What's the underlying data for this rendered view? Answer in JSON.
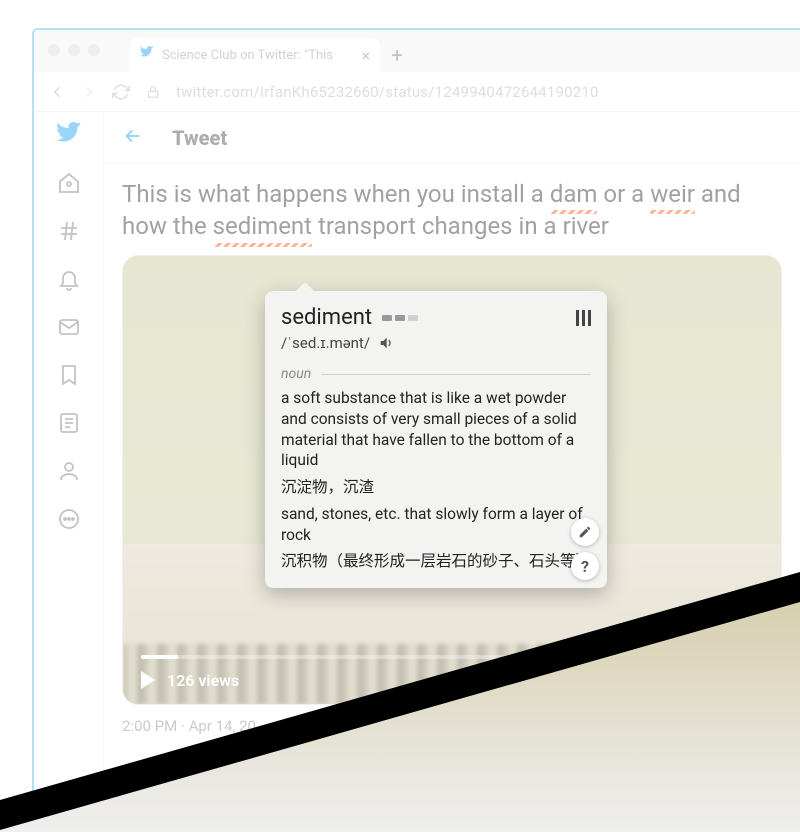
{
  "browser": {
    "tab_title": "Science Club on Twitter: \"This",
    "url": "twitter.com/IrfanKh65232660/status/1249940472644190210"
  },
  "header": {
    "title": "Tweet"
  },
  "tweet": {
    "text_parts": [
      "This is what happens when you install a ",
      "dam",
      " or a ",
      "weir",
      " and how the ",
      "sediment",
      " transport changes in a river"
    ],
    "views_label": "126 views",
    "timestamp": "2:00 PM · Apr 14, 20"
  },
  "dictionary": {
    "word": "sediment",
    "ipa": "/ˈsed.ɪ.mənt/",
    "part_of_speech": "noun",
    "definitions": [
      "a soft substance that is like a wet powder and consists of very small pieces of a solid material that have fallen to the bottom of a liquid",
      "沉淀物，沉渣",
      "sand, stones, etc. that slowly form a layer of rock",
      "沉积物（最终形成一层岩石的砂子、石头等）"
    ]
  },
  "icons": {
    "twitter": "twitter-bird-icon",
    "home": "home-icon",
    "explore": "hashtag-icon",
    "notifications": "bell-icon",
    "messages": "envelope-icon",
    "bookmarks": "bookmark-icon",
    "lists": "list-icon",
    "profile": "person-icon",
    "more": "more-icon",
    "back": "arrow-left-icon",
    "lock": "lock-icon",
    "speaker": "speaker-icon",
    "edit": "pencil-icon",
    "help": "question-icon",
    "columns": "columns-icon"
  }
}
